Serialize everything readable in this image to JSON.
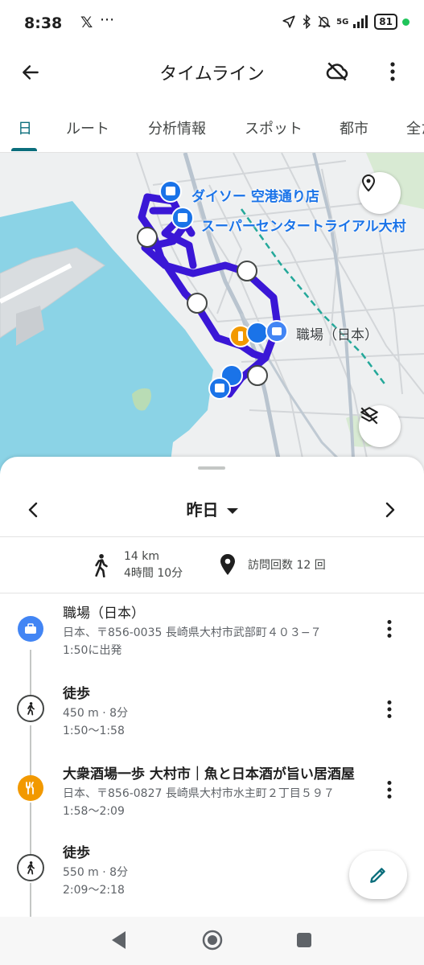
{
  "status_bar": {
    "time": "8:38",
    "x_icon": "x-logo",
    "more": "···",
    "network": "5G",
    "battery": "81"
  },
  "app_bar": {
    "title": "タイムライン"
  },
  "tabs": [
    {
      "label": "日",
      "active": true
    },
    {
      "label": "ルート",
      "active": false
    },
    {
      "label": "分析情報",
      "active": false
    },
    {
      "label": "スポット",
      "active": false
    },
    {
      "label": "都市",
      "active": false
    },
    {
      "label": "全た",
      "active": false
    }
  ],
  "map": {
    "labels": {
      "daiso": "ダイソー 空港通り店",
      "supercenter": "スーパーセンタートライアル大村",
      "work": "職場（日本）"
    },
    "route_color": "#3a17d6"
  },
  "sheet": {
    "date": "昨日",
    "summary": {
      "distance": "14 km",
      "duration": "4時間 10分",
      "visits": "訪問回数 12 回"
    },
    "items": [
      {
        "type": "work",
        "title": "職場（日本）",
        "line1": "日本、〒856-0035 長崎県大村市武部町４０３−７",
        "line2": "1:50に出発"
      },
      {
        "type": "walk",
        "title": "徒歩",
        "line1": "450 m · 8分",
        "line2": "1:50〜1:58"
      },
      {
        "type": "food",
        "title": "大衆酒場一歩 大村市｜魚と日本酒が旨い居酒屋",
        "line1": "日本、〒856-0827 長崎県大村市水主町２丁目５９７",
        "line2": "1:58〜2:09"
      },
      {
        "type": "walk",
        "title": "徒歩",
        "line1": "550 m · 8分",
        "line2": "2:09〜2:18"
      }
    ]
  },
  "colors": {
    "accent": "#0b6e7c",
    "work": "#4285f4",
    "food": "#f29900",
    "route": "#3a17d6"
  }
}
